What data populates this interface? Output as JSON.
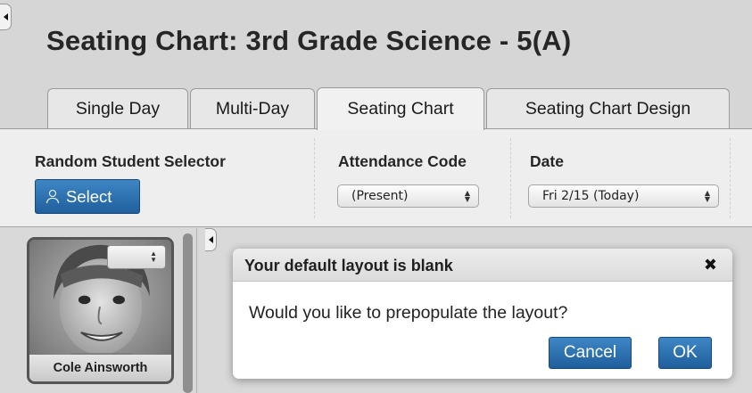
{
  "page": {
    "title": "Seating Chart: 3rd Grade Science - 5(A)"
  },
  "tabs": [
    {
      "label": "Single Day",
      "active": false
    },
    {
      "label": "Multi-Day",
      "active": false
    },
    {
      "label": "Seating Chart",
      "active": true
    },
    {
      "label": "Seating Chart Design",
      "active": false
    }
  ],
  "toolbar": {
    "random_selector_label": "Random Student Selector",
    "select_button_label": "Select",
    "attendance_label": "Attendance Code",
    "attendance_value": "(Present)",
    "date_label": "Date",
    "date_value": "Fri 2/15 (Today)"
  },
  "student_card": {
    "name": "Cole Ainsworth"
  },
  "modal": {
    "title": "Your default layout is blank",
    "close_symbol": "✖",
    "message": "Would you like to prepopulate the layout?",
    "cancel_label": "Cancel",
    "ok_label": "OK"
  },
  "icons": {
    "collapse": "collapse-left-icon",
    "person": "person-icon",
    "updown": "updown-arrows-icon",
    "close": "close-icon"
  },
  "colors": {
    "primary_button": "#2a6fae",
    "background": "#d6d6d6",
    "toolbar_bg": "#eeeeee"
  }
}
